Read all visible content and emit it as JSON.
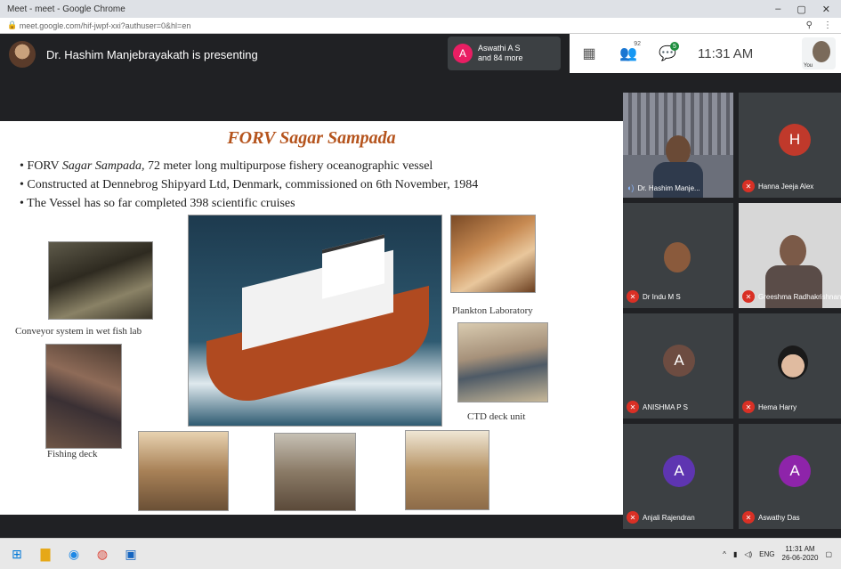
{
  "browser": {
    "tab_title": "Meet - meet - Google Chrome",
    "url": "meet.google.com/hif-jwpf-xxi?authuser=0&hl=en",
    "controls": [
      "–",
      "▢",
      "✕"
    ],
    "url_icons": [
      "⚲",
      "⋮"
    ]
  },
  "meet": {
    "presenter_text": "Dr. Hashim Manjebrayakath is presenting",
    "participants_chip": {
      "avatar_letter": "A",
      "line1": "Aswathi A S",
      "line2": "and 84 more"
    },
    "icons": {
      "people_count": "92",
      "chat_badge": "5"
    },
    "time": "11:31 AM",
    "you_label": "You"
  },
  "slide": {
    "title": "FORV Sagar Sampada",
    "bullet1_prefix": "FORV ",
    "bullet1_italic": "Sagar Sampada,",
    "bullet1_rest": " 72  meter long multipurpose fishery oceanographic vessel",
    "bullet2": "Constructed at Dennebrog Shipyard Ltd, Denmark, commissioned on 6th November, 1984",
    "bullet3": "The Vessel has so far completed 398 scientific cruises",
    "captions": {
      "conveyor": "Conveyor system in wet fish lab",
      "fishing": "Fishing deck",
      "plankton": "Plankton Laboratory",
      "ctd": "CTD deck unit"
    }
  },
  "tiles": [
    {
      "name": "Dr. Hashim Manje...",
      "type": "video",
      "mic": "on"
    },
    {
      "name": "Hanna Jeeja Alex",
      "avatar": "H",
      "color": "#c0392b",
      "mic": "off"
    },
    {
      "name": "Dr Indu M S",
      "type": "video",
      "mic": "off"
    },
    {
      "name": "Greeshma Radhakrishnan",
      "type": "video",
      "mic": "off"
    },
    {
      "name": "ANISHMA P S",
      "avatar": "A",
      "color": "#6d4c41",
      "mic": "off"
    },
    {
      "name": "Hema Harry",
      "type": "video",
      "mic": "off"
    },
    {
      "name": "Anjali Rajendran",
      "avatar": "A",
      "color": "#5e35b1",
      "mic": "off"
    },
    {
      "name": "Aswathy Das",
      "avatar": "A",
      "color": "#8e24aa",
      "mic": "off"
    }
  ],
  "taskbar": {
    "time": "11:31 AM",
    "date": "26-06-2020",
    "lang": "ENG"
  }
}
